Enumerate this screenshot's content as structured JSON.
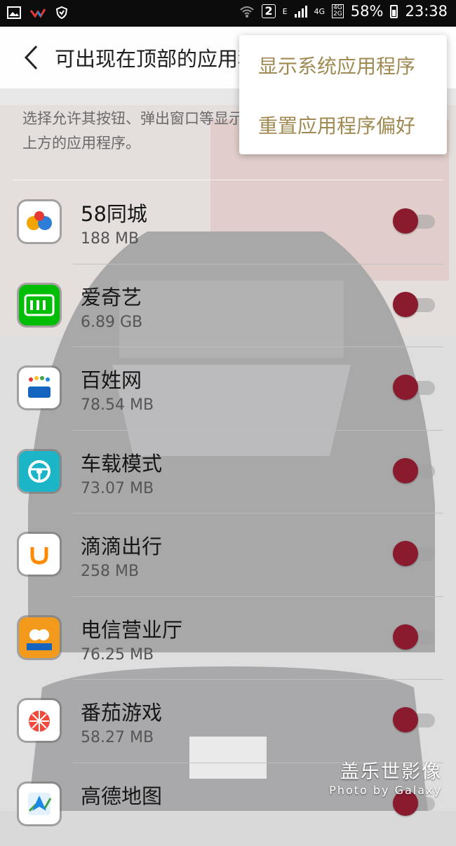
{
  "status_bar": {
    "sim_badge": "2",
    "network_e": "E",
    "network_4g": "4G",
    "network_4g_2g_top": "4G",
    "network_4g_2g_bottom": "2G",
    "battery": "58%",
    "time": "23:38",
    "icons": [
      "gallery-icon",
      "weibo-icon",
      "vpn-shield-icon",
      "wifi-icon",
      "signal-icon",
      "battery-icon"
    ]
  },
  "header": {
    "title": "可出现在顶部的应用程序"
  },
  "description": "选择允许其按钮、弹出窗口等显示在您正在使用的其他应用程序上方的应用程序。",
  "menu": {
    "items": [
      "显示系统应用程序",
      "重置应用程序偏好"
    ]
  },
  "apps": [
    {
      "name": "58同城",
      "size": "188 MB",
      "icon": "58-icon",
      "enabled": true
    },
    {
      "name": "爱奇艺",
      "size": "6.89 GB",
      "icon": "iqiyi-icon",
      "enabled": true
    },
    {
      "name": "百姓网",
      "size": "78.54 MB",
      "icon": "baixing-icon",
      "enabled": true
    },
    {
      "name": "车载模式",
      "size": "73.07 MB",
      "icon": "car-mode-icon",
      "enabled": true
    },
    {
      "name": "滴滴出行",
      "size": "258 MB",
      "icon": "didi-icon",
      "enabled": true
    },
    {
      "name": "电信营业厅",
      "size": "76.25 MB",
      "icon": "telecom-icon",
      "enabled": true
    },
    {
      "name": "番茄游戏",
      "size": "58.27 MB",
      "icon": "tomato-games-icon",
      "enabled": true
    },
    {
      "name": "高德地图",
      "size": "",
      "icon": "amap-icon",
      "enabled": true
    }
  ],
  "watermark": {
    "title": "盖乐世影像",
    "subtitle": "Photo by Galaxy"
  },
  "colors": {
    "toggle_on": "#8a1a2e",
    "menu_text": "#a08a52"
  }
}
